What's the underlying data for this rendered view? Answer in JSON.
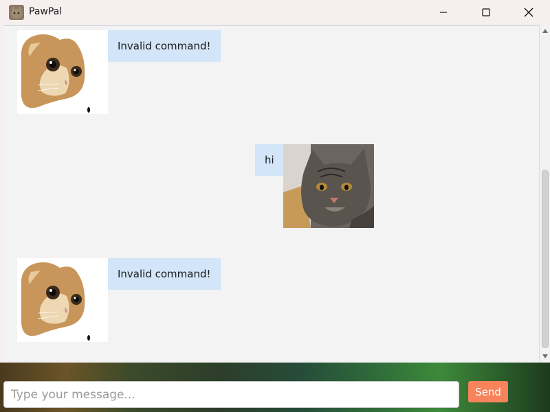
{
  "window": {
    "title": "PawPal",
    "icon": "cat-app-icon"
  },
  "messages": [
    {
      "sender": "bot",
      "text": "Invalid command!",
      "avatar": "orange-cat-avatar"
    },
    {
      "sender": "user",
      "text": "hi",
      "avatar": "tabby-cat-avatar"
    },
    {
      "sender": "bot",
      "text": "Invalid command!",
      "avatar": "orange-cat-avatar"
    }
  ],
  "composer": {
    "placeholder": "Type your message...",
    "value": "",
    "send_label": "Send"
  },
  "colors": {
    "bubble": "#d3e5f8",
    "send_button": "#f7835a",
    "chat_background": "#f3f3f3"
  }
}
